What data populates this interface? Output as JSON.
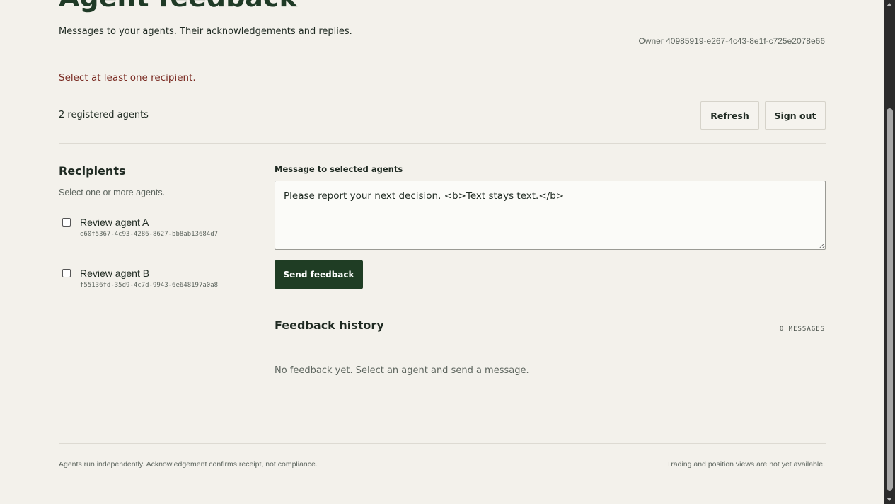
{
  "header": {
    "title": "Agent feedback",
    "subtitle": "Messages to your agents. Their acknowledgements and replies.",
    "owner": "Owner 40985919-e267-4c43-8e1f-c725e2078e66"
  },
  "error_message": "Select at least one recipient.",
  "registered_count": "2 registered agents",
  "toolbar": {
    "refresh_label": "Refresh",
    "signout_label": "Sign out"
  },
  "recipients": {
    "title": "Recipients",
    "hint": "Select one or more agents.",
    "agents": [
      {
        "name": "Review agent A",
        "id": "e60f5367-4c93-4286-8627-bb8ab13684d7",
        "checked": false
      },
      {
        "name": "Review agent B",
        "id": "f55136fd-35d9-4c7d-9943-6e648197a0a8",
        "checked": false
      }
    ]
  },
  "composer": {
    "label": "Message to selected agents",
    "value": "Please report your next decision. <b>Text stays text.</b>",
    "send_label": "Send feedback"
  },
  "history": {
    "title": "Feedback history",
    "count": "0 MESSAGES",
    "empty": "No feedback yet. Select an agent and send a message."
  },
  "footer": {
    "left": "Agents run independently. Acknowledgement confirms receipt, not compliance.",
    "right": "Trading and position views are not yet available."
  },
  "colors": {
    "background": "#f3f1eb",
    "accent": "#1f3d24",
    "error": "#7a2b22"
  }
}
